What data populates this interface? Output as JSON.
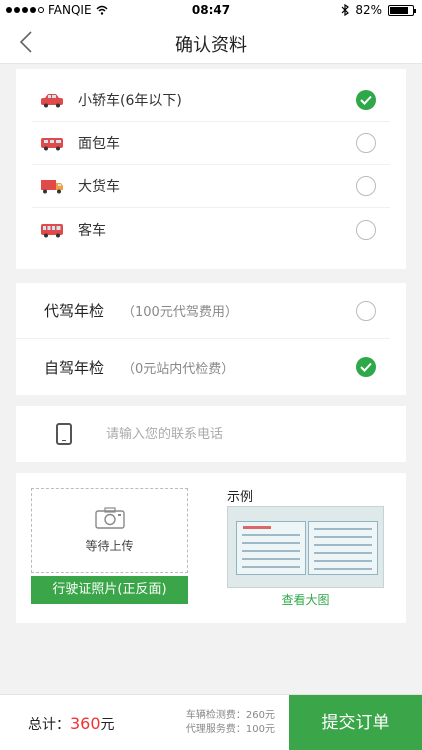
{
  "status_bar": {
    "carrier": "FANQIE",
    "time": "08:47",
    "battery": "82%",
    "battery_level": 0.82
  },
  "nav": {
    "title": "确认资料"
  },
  "vehicles": [
    {
      "label": "小轿车(6年以下)",
      "icon": "car-icon",
      "selected": true
    },
    {
      "label": "面包车",
      "icon": "van-icon",
      "selected": false
    },
    {
      "label": "大货车",
      "icon": "truck-icon",
      "selected": false
    },
    {
      "label": "客车",
      "icon": "bus-icon",
      "selected": false
    }
  ],
  "inspection": [
    {
      "label": "代驾年检",
      "note": "（100元代驾费用）",
      "selected": false
    },
    {
      "label": "自驾年检",
      "note": "（0元站内代检费）",
      "selected": true
    }
  ],
  "phone": {
    "placeholder": "请输入您的联系电话",
    "icon": "phone-icon"
  },
  "upload": {
    "waiting": "等待上传",
    "button": "行驶证照片(正反面)",
    "example_label": "示例",
    "view_large": "查看大图",
    "icon": "camera-icon"
  },
  "footer": {
    "total_label": "总计：",
    "total_amount": "360",
    "total_unit": "元",
    "fee_inspection": "车辆检测费：260元",
    "fee_service": "代理服务费：100元",
    "submit": "提交订单"
  },
  "colors": {
    "accent": "#3aa649",
    "price": "#ee3333",
    "background": "#f2f2f2"
  }
}
